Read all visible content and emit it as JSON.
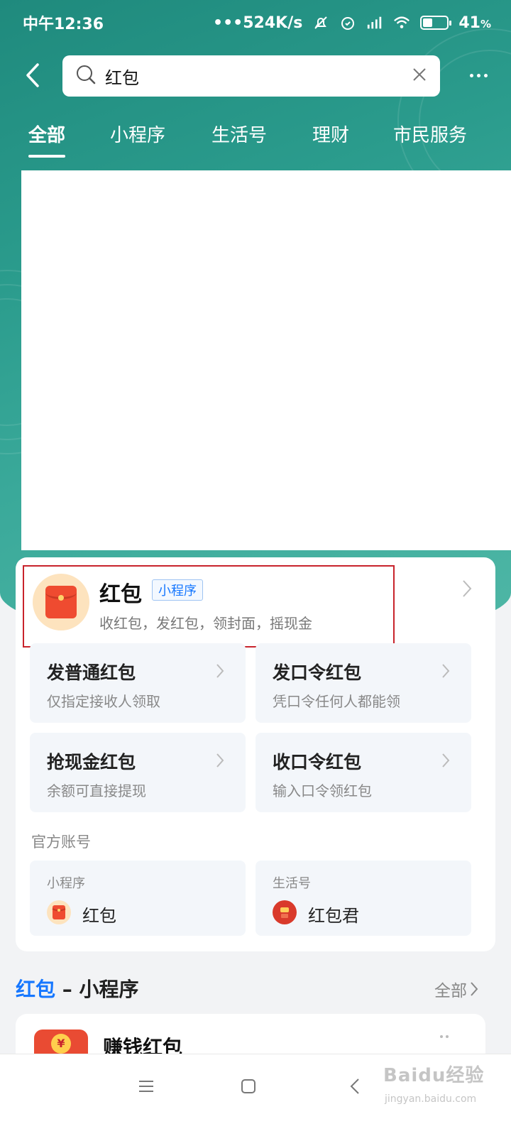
{
  "status_bar": {
    "time": "中午12:36",
    "network_speed": "•••524K/s",
    "battery_percent": "41",
    "battery_unit": "%",
    "icons": [
      "bell-muted-icon",
      "alarm-icon",
      "hd-signal-icon",
      "wifi-icon",
      "battery-icon"
    ]
  },
  "search": {
    "query": "红包"
  },
  "tabs": [
    {
      "label": "全部",
      "active": true
    },
    {
      "label": "小程序",
      "active": false
    },
    {
      "label": "生活号",
      "active": false
    },
    {
      "label": "理财",
      "active": false
    },
    {
      "label": "市民服务",
      "active": false
    }
  ],
  "top_result": {
    "title": "红包",
    "tag": "小程序",
    "description": "收红包，发红包，领封面，摇现金"
  },
  "services": [
    {
      "title": "发普通红包",
      "subtitle": "仅指定接收人领取"
    },
    {
      "title": "发口令红包",
      "subtitle": "凭口令任何人都能领"
    },
    {
      "title": "抢现金红包",
      "subtitle": "余额可直接提现"
    },
    {
      "title": "收口令红包",
      "subtitle": "输入口令领红包"
    }
  ],
  "official_accounts": {
    "label": "官方账号",
    "items": [
      {
        "type": "小程序",
        "name": "红包"
      },
      {
        "type": "生活号",
        "name": "红包君"
      }
    ]
  },
  "miniapp_section": {
    "keyword": "红包",
    "suffix": " – 小程序",
    "see_all": "全部"
  },
  "results": [
    {
      "title": "赚钱红包"
    }
  ],
  "watermark": {
    "text": "Baidu经验",
    "sub": "jingyan.baidu.com"
  },
  "colors": {
    "accent_blue": "#1677ff",
    "highlight_red": "#c8232c",
    "header_teal": "#2b9c8d"
  }
}
